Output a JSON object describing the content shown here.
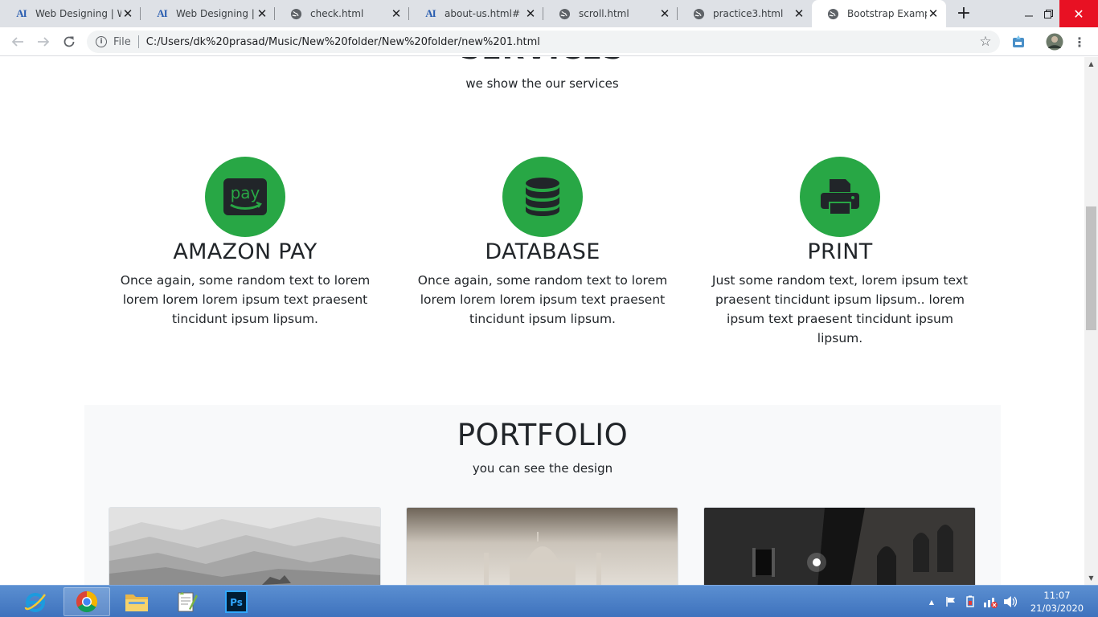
{
  "browser": {
    "tabs": [
      {
        "title": "Web Designing | W",
        "icon": "AI"
      },
      {
        "title": "Web Designing | W",
        "icon": "AI"
      },
      {
        "title": "check.html",
        "icon": "globe"
      },
      {
        "title": "about-us.html#",
        "icon": "AI"
      },
      {
        "title": "scroll.html",
        "icon": "globe"
      },
      {
        "title": "practice3.html",
        "icon": "globe"
      },
      {
        "title": "Bootstrap Example",
        "icon": "globe"
      }
    ],
    "active_tab_index": 6,
    "address": {
      "scheme_label": "File",
      "url": "C:/Users/dk%20prasad/Music/New%20folder/New%20folder/new%201.html"
    }
  },
  "page": {
    "services": {
      "heading": "SERVICES",
      "subtitle": "we show the our services",
      "items": [
        {
          "icon": "amazon-pay-icon",
          "title": "AMAZON PAY",
          "text": "Once again, some random text to lorem lorem lorem lorem ipsum text praesent tincidunt ipsum lipsum."
        },
        {
          "icon": "database-icon",
          "title": "DATABASE",
          "text": "Once again, some random text to lorem lorem lorem lorem ipsum text praesent tincidunt ipsum lipsum."
        },
        {
          "icon": "print-icon",
          "title": "PRINT",
          "text": "Just some random text, lorem ipsum text praesent tincidunt ipsum lipsum.. lorem ipsum text praesent tincidunt ipsum lipsum."
        }
      ],
      "icon_glyph_text": "pay"
    },
    "portfolio": {
      "heading": "PORTFOLIO",
      "subtitle": "you can see the design",
      "images": [
        "mountains-image",
        "taj-mahal-image",
        "night-street-image"
      ]
    }
  },
  "colors": {
    "accent_green": "#28a745",
    "text_dark": "#212529"
  },
  "taskbar": {
    "apps": [
      "internet-explorer-icon",
      "chrome-icon",
      "file-explorer-icon",
      "notepad-plus-plus-icon",
      "photoshop-icon"
    ],
    "photoshop_label": "Ps",
    "time": "11:07",
    "date": "21/03/2020"
  }
}
